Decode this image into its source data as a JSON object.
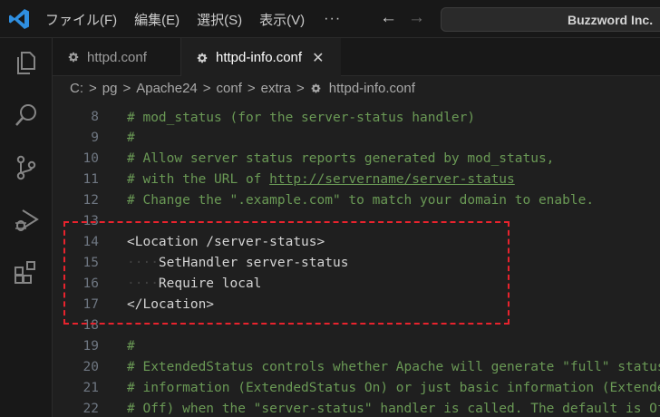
{
  "menu": {
    "items": [
      "ファイル(F)",
      "編集(E)",
      "選択(S)",
      "表示(V)"
    ],
    "more": "···"
  },
  "nav": {
    "back": "←",
    "forward": "→"
  },
  "command_center": {
    "label": "Buzzword Inc."
  },
  "tabs": [
    {
      "label": "httpd.conf",
      "icon": "gear-icon",
      "active": false
    },
    {
      "label": "httpd-info.conf",
      "icon": "gear-icon",
      "active": true,
      "close": "✕"
    }
  ],
  "breadcrumb": [
    "C:",
    "pg",
    "Apache24",
    "conf",
    "extra",
    "httpd-info.conf"
  ],
  "breadcrumb_sep": ">",
  "editor": {
    "top_partial": "# mod_status (for the server-status handler)",
    "lines": [
      {
        "num": "8",
        "kind": "blank",
        "text": ""
      },
      {
        "num": "9",
        "kind": "comment",
        "text": "#"
      },
      {
        "num": "10",
        "kind": "comment",
        "text": "# Allow server status reports generated by mod_status,"
      },
      {
        "num": "11",
        "kind": "comment-url",
        "text": "# with the URL of ",
        "url": "http://servername/server-status"
      },
      {
        "num": "12",
        "kind": "comment",
        "text": "# Change the \".example.com\" to match your domain to enable."
      },
      {
        "num": "13",
        "kind": "blank",
        "text": ""
      },
      {
        "num": "14",
        "kind": "tag",
        "text": "<Location /server-status>"
      },
      {
        "num": "15",
        "kind": "indent",
        "ws": "····",
        "text": "SetHandler server-status"
      },
      {
        "num": "16",
        "kind": "indent",
        "ws": "····",
        "text": "Require local"
      },
      {
        "num": "17",
        "kind": "tag",
        "text": "</Location>"
      },
      {
        "num": "18",
        "kind": "blank",
        "text": ""
      },
      {
        "num": "19",
        "kind": "comment",
        "text": "#"
      },
      {
        "num": "20",
        "kind": "comment",
        "text": "# ExtendedStatus controls whether Apache will generate \"full\" status"
      },
      {
        "num": "21",
        "kind": "comment",
        "text": "# information (ExtendedStatus On) or just basic information (ExtendedStatus"
      },
      {
        "num": "22",
        "kind": "comment",
        "text": "# Off) when the \"server-status\" handler is called. The default is Off."
      }
    ]
  },
  "colors": {
    "comment": "#6a9955",
    "highlight_border": "#e8232d",
    "editor_bg": "#1f1f1f"
  }
}
